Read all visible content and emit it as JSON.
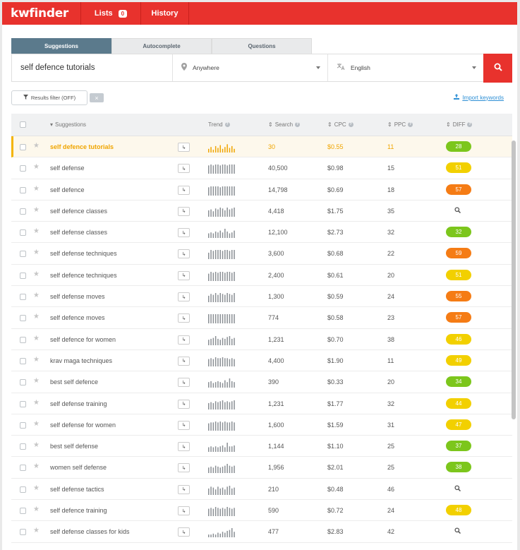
{
  "app": {
    "logo": "kwfinder"
  },
  "nav": {
    "lists_label": "Lists",
    "lists_count": "0",
    "history_label": "History"
  },
  "tabs": [
    {
      "label": "Suggestions",
      "active": true
    },
    {
      "label": "Autocomplete",
      "active": false
    },
    {
      "label": "Questions",
      "active": false
    }
  ],
  "search": {
    "query": "self defence tutorials",
    "location": "Anywhere",
    "language": "English",
    "button_icon": "search-icon"
  },
  "filter": {
    "label": "Results filter (OFF)"
  },
  "import_label": "Import keywords",
  "table": {
    "headers": {
      "suggestions": "Suggestions",
      "trend": "Trend",
      "search": "Search",
      "cpc": "CPC",
      "ppc": "PPC",
      "diff": "DIFF"
    },
    "colors": {
      "green": "#7cc61c",
      "yellow": "#f2d000",
      "orange": "#f57c15"
    },
    "rows": [
      {
        "keyword": "self defence tutorials",
        "search": "30",
        "cpc": "$0.55",
        "ppc": "11",
        "diff": "28",
        "diff_color": "green",
        "trend": [
          4,
          6,
          3,
          7,
          5,
          8,
          4,
          6,
          9,
          5,
          7,
          4
        ]
      },
      {
        "keyword": "self defense",
        "search": "40,500",
        "cpc": "$0.98",
        "ppc": "15",
        "diff": "51",
        "diff_color": "yellow",
        "trend": [
          9,
          10,
          9,
          10,
          10,
          9,
          10,
          10,
          9,
          10,
          10,
          10
        ]
      },
      {
        "keyword": "self defence",
        "search": "14,798",
        "cpc": "$0.69",
        "ppc": "18",
        "diff": "57",
        "diff_color": "orange",
        "trend": [
          9,
          10,
          10,
          10,
          10,
          9,
          10,
          10,
          10,
          10,
          10,
          10
        ]
      },
      {
        "keyword": "self defence classes",
        "search": "4,418",
        "cpc": "$1.75",
        "ppc": "35",
        "diff": "",
        "diff_color": "none",
        "trend": [
          7,
          8,
          6,
          9,
          8,
          10,
          9,
          7,
          10,
          8,
          9,
          10
        ]
      },
      {
        "keyword": "self defense classes",
        "search": "12,100",
        "cpc": "$2.73",
        "ppc": "32",
        "diff": "32",
        "diff_color": "green",
        "trend": [
          5,
          6,
          5,
          7,
          6,
          8,
          6,
          10,
          7,
          5,
          6,
          8
        ]
      },
      {
        "keyword": "self defense techniques",
        "search": "3,600",
        "cpc": "$0.68",
        "ppc": "22",
        "diff": "59",
        "diff_color": "orange",
        "trend": [
          7,
          10,
          9,
          10,
          10,
          10,
          9,
          10,
          10,
          9,
          10,
          10
        ]
      },
      {
        "keyword": "self defence techniques",
        "search": "2,400",
        "cpc": "$0.61",
        "ppc": "20",
        "diff": "51",
        "diff_color": "yellow",
        "trend": [
          8,
          10,
          9,
          10,
          9,
          10,
          10,
          9,
          10,
          10,
          9,
          10
        ]
      },
      {
        "keyword": "self defense moves",
        "search": "1,300",
        "cpc": "$0.59",
        "ppc": "24",
        "diff": "55",
        "diff_color": "orange",
        "trend": [
          7,
          9,
          8,
          10,
          8,
          10,
          9,
          8,
          10,
          9,
          8,
          10
        ]
      },
      {
        "keyword": "self defence moves",
        "search": "774",
        "cpc": "$0.58",
        "ppc": "23",
        "diff": "57",
        "diff_color": "orange",
        "trend": [
          10,
          10,
          10,
          10,
          10,
          10,
          10,
          10,
          10,
          10,
          10,
          10
        ]
      },
      {
        "keyword": "self defence for women",
        "search": "1,231",
        "cpc": "$0.70",
        "ppc": "38",
        "diff": "46",
        "diff_color": "yellow",
        "trend": [
          6,
          7,
          8,
          10,
          7,
          6,
          8,
          7,
          9,
          10,
          7,
          8
        ]
      },
      {
        "keyword": "krav maga techniques",
        "search": "4,400",
        "cpc": "$1.90",
        "ppc": "11",
        "diff": "49",
        "diff_color": "yellow",
        "trend": [
          8,
          9,
          8,
          10,
          9,
          9,
          10,
          9,
          9,
          8,
          9,
          8
        ]
      },
      {
        "keyword": "best self defence",
        "search": "390",
        "cpc": "$0.33",
        "ppc": "20",
        "diff": "34",
        "diff_color": "green",
        "trend": [
          6,
          7,
          5,
          6,
          7,
          6,
          5,
          8,
          6,
          10,
          7,
          6
        ]
      },
      {
        "keyword": "self defense training",
        "search": "1,231",
        "cpc": "$1.77",
        "ppc": "32",
        "diff": "44",
        "diff_color": "yellow",
        "trend": [
          7,
          8,
          7,
          9,
          8,
          9,
          10,
          8,
          9,
          8,
          9,
          10
        ]
      },
      {
        "keyword": "self defense for women",
        "search": "1,600",
        "cpc": "$1.59",
        "ppc": "31",
        "diff": "47",
        "diff_color": "yellow",
        "trend": [
          8,
          9,
          9,
          10,
          9,
          10,
          9,
          10,
          9,
          9,
          10,
          9
        ]
      },
      {
        "keyword": "best self defense",
        "search": "1,144",
        "cpc": "$1.10",
        "ppc": "25",
        "diff": "37",
        "diff_color": "green",
        "trend": [
          5,
          6,
          5,
          6,
          5,
          6,
          7,
          5,
          10,
          6,
          6,
          7
        ]
      },
      {
        "keyword": "women self defense",
        "search": "1,956",
        "cpc": "$2.01",
        "ppc": "25",
        "diff": "38",
        "diff_color": "green",
        "trend": [
          6,
          7,
          6,
          8,
          7,
          6,
          7,
          8,
          10,
          8,
          7,
          8
        ]
      },
      {
        "keyword": "self defense tactics",
        "search": "210",
        "cpc": "$0.48",
        "ppc": "46",
        "diff": "",
        "diff_color": "none",
        "trend": [
          7,
          9,
          8,
          6,
          9,
          7,
          8,
          6,
          9,
          10,
          7,
          8
        ]
      },
      {
        "keyword": "self defence training",
        "search": "590",
        "cpc": "$0.72",
        "ppc": "24",
        "diff": "48",
        "diff_color": "yellow",
        "trend": [
          8,
          9,
          8,
          10,
          9,
          8,
          9,
          8,
          10,
          9,
          8,
          9
        ]
      },
      {
        "keyword": "self defense classes for kids",
        "search": "477",
        "cpc": "$2.83",
        "ppc": "42",
        "diff": "",
        "diff_color": "none",
        "trend": [
          3,
          3,
          4,
          3,
          5,
          4,
          6,
          5,
          7,
          8,
          10,
          6
        ]
      }
    ]
  }
}
